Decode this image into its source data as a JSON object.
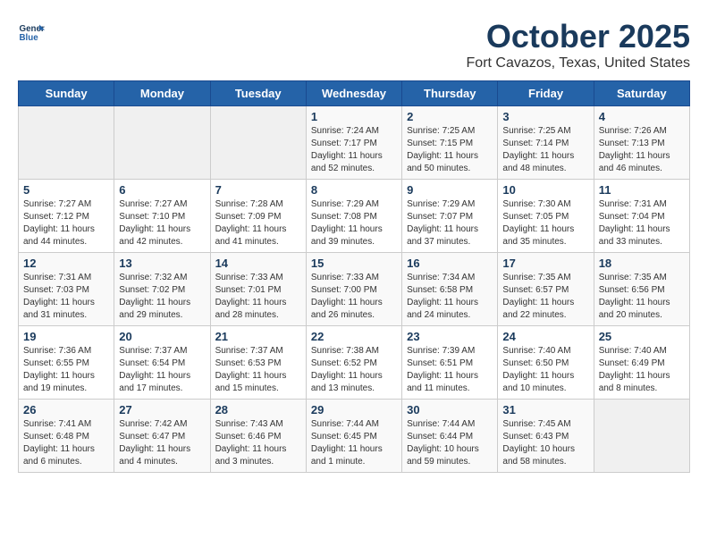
{
  "header": {
    "logo_line1": "General",
    "logo_line2": "Blue",
    "title": "October 2025",
    "subtitle": "Fort Cavazos, Texas, United States"
  },
  "weekdays": [
    "Sunday",
    "Monday",
    "Tuesday",
    "Wednesday",
    "Thursday",
    "Friday",
    "Saturday"
  ],
  "weeks": [
    [
      {
        "num": "",
        "info": ""
      },
      {
        "num": "",
        "info": ""
      },
      {
        "num": "",
        "info": ""
      },
      {
        "num": "1",
        "info": "Sunrise: 7:24 AM\nSunset: 7:17 PM\nDaylight: 11 hours\nand 52 minutes."
      },
      {
        "num": "2",
        "info": "Sunrise: 7:25 AM\nSunset: 7:15 PM\nDaylight: 11 hours\nand 50 minutes."
      },
      {
        "num": "3",
        "info": "Sunrise: 7:25 AM\nSunset: 7:14 PM\nDaylight: 11 hours\nand 48 minutes."
      },
      {
        "num": "4",
        "info": "Sunrise: 7:26 AM\nSunset: 7:13 PM\nDaylight: 11 hours\nand 46 minutes."
      }
    ],
    [
      {
        "num": "5",
        "info": "Sunrise: 7:27 AM\nSunset: 7:12 PM\nDaylight: 11 hours\nand 44 minutes."
      },
      {
        "num": "6",
        "info": "Sunrise: 7:27 AM\nSunset: 7:10 PM\nDaylight: 11 hours\nand 42 minutes."
      },
      {
        "num": "7",
        "info": "Sunrise: 7:28 AM\nSunset: 7:09 PM\nDaylight: 11 hours\nand 41 minutes."
      },
      {
        "num": "8",
        "info": "Sunrise: 7:29 AM\nSunset: 7:08 PM\nDaylight: 11 hours\nand 39 minutes."
      },
      {
        "num": "9",
        "info": "Sunrise: 7:29 AM\nSunset: 7:07 PM\nDaylight: 11 hours\nand 37 minutes."
      },
      {
        "num": "10",
        "info": "Sunrise: 7:30 AM\nSunset: 7:05 PM\nDaylight: 11 hours\nand 35 minutes."
      },
      {
        "num": "11",
        "info": "Sunrise: 7:31 AM\nSunset: 7:04 PM\nDaylight: 11 hours\nand 33 minutes."
      }
    ],
    [
      {
        "num": "12",
        "info": "Sunrise: 7:31 AM\nSunset: 7:03 PM\nDaylight: 11 hours\nand 31 minutes."
      },
      {
        "num": "13",
        "info": "Sunrise: 7:32 AM\nSunset: 7:02 PM\nDaylight: 11 hours\nand 29 minutes."
      },
      {
        "num": "14",
        "info": "Sunrise: 7:33 AM\nSunset: 7:01 PM\nDaylight: 11 hours\nand 28 minutes."
      },
      {
        "num": "15",
        "info": "Sunrise: 7:33 AM\nSunset: 7:00 PM\nDaylight: 11 hours\nand 26 minutes."
      },
      {
        "num": "16",
        "info": "Sunrise: 7:34 AM\nSunset: 6:58 PM\nDaylight: 11 hours\nand 24 minutes."
      },
      {
        "num": "17",
        "info": "Sunrise: 7:35 AM\nSunset: 6:57 PM\nDaylight: 11 hours\nand 22 minutes."
      },
      {
        "num": "18",
        "info": "Sunrise: 7:35 AM\nSunset: 6:56 PM\nDaylight: 11 hours\nand 20 minutes."
      }
    ],
    [
      {
        "num": "19",
        "info": "Sunrise: 7:36 AM\nSunset: 6:55 PM\nDaylight: 11 hours\nand 19 minutes."
      },
      {
        "num": "20",
        "info": "Sunrise: 7:37 AM\nSunset: 6:54 PM\nDaylight: 11 hours\nand 17 minutes."
      },
      {
        "num": "21",
        "info": "Sunrise: 7:37 AM\nSunset: 6:53 PM\nDaylight: 11 hours\nand 15 minutes."
      },
      {
        "num": "22",
        "info": "Sunrise: 7:38 AM\nSunset: 6:52 PM\nDaylight: 11 hours\nand 13 minutes."
      },
      {
        "num": "23",
        "info": "Sunrise: 7:39 AM\nSunset: 6:51 PM\nDaylight: 11 hours\nand 11 minutes."
      },
      {
        "num": "24",
        "info": "Sunrise: 7:40 AM\nSunset: 6:50 PM\nDaylight: 11 hours\nand 10 minutes."
      },
      {
        "num": "25",
        "info": "Sunrise: 7:40 AM\nSunset: 6:49 PM\nDaylight: 11 hours\nand 8 minutes."
      }
    ],
    [
      {
        "num": "26",
        "info": "Sunrise: 7:41 AM\nSunset: 6:48 PM\nDaylight: 11 hours\nand 6 minutes."
      },
      {
        "num": "27",
        "info": "Sunrise: 7:42 AM\nSunset: 6:47 PM\nDaylight: 11 hours\nand 4 minutes."
      },
      {
        "num": "28",
        "info": "Sunrise: 7:43 AM\nSunset: 6:46 PM\nDaylight: 11 hours\nand 3 minutes."
      },
      {
        "num": "29",
        "info": "Sunrise: 7:44 AM\nSunset: 6:45 PM\nDaylight: 11 hours\nand 1 minute."
      },
      {
        "num": "30",
        "info": "Sunrise: 7:44 AM\nSunset: 6:44 PM\nDaylight: 10 hours\nand 59 minutes."
      },
      {
        "num": "31",
        "info": "Sunrise: 7:45 AM\nSunset: 6:43 PM\nDaylight: 10 hours\nand 58 minutes."
      },
      {
        "num": "",
        "info": ""
      }
    ]
  ]
}
